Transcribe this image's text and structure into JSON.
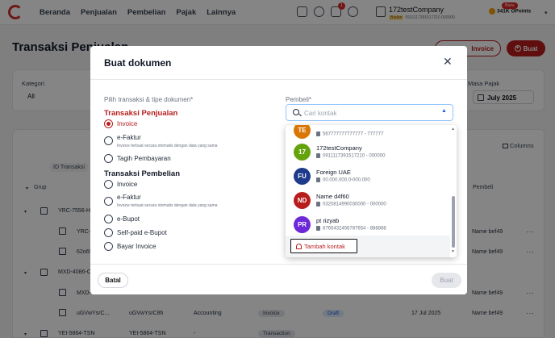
{
  "navbar": {
    "menu": [
      "Beranda",
      "Penjualan",
      "Pembelian",
      "Pajak",
      "Lainnya"
    ],
    "notification_count": "1",
    "company": {
      "name": "172testCompany",
      "badge": "Badan",
      "npwp": "0911117391517210 000000"
    },
    "points": {
      "new_badge": "Baru",
      "label": "341K OPoints"
    }
  },
  "page": {
    "title": "Transaksi Penjualan",
    "invoice_button": "Invoice",
    "create_button": "Buat",
    "filters": {
      "category_label": "Kategori",
      "category_value": "All",
      "tax_period_label": "Masa Pajak",
      "tax_period_value": "July 2025"
    },
    "columns_button": "Columns",
    "id_column_chip": "ID Transaksi",
    "header_group": "Grup",
    "header_buyer": "Pembeli",
    "rows": [
      {
        "id": "YRC-7556-H",
        "buyer": ""
      },
      {
        "id": "YRC-",
        "buyer": "Name bef49"
      },
      {
        "id": "62o65",
        "buyer": "Name bef49"
      },
      {
        "id": "MXD-4086-C",
        "buyer": ""
      },
      {
        "id": "MXD-",
        "buyer": "Name bef49"
      },
      {
        "id": "uGVwYsrC...",
        "id2": "uGVwYsrC8h",
        "category": "Accounting",
        "type": "Invoice",
        "status": "Draft",
        "date": "17 Jul 2025",
        "buyer": "Name bef49"
      },
      {
        "id": "YEI-5864-TSN",
        "id2": "YEI-5864-TSN",
        "category": "-",
        "type": "Transaction",
        "buyer": ""
      }
    ]
  },
  "modal": {
    "title": "Buat dokumen",
    "choose_label": "Pilih transaksi & tipe dokumen*",
    "sales_group": "Transaksi Penjualan",
    "sales_options": [
      {
        "label": "Invoice",
        "selected": true
      },
      {
        "label": "e-Faktur",
        "desc": "Invoice terbuat secara otomatis dengan data yang sama"
      },
      {
        "label": "Tagih Pembayaran"
      }
    ],
    "purchase_group": "Transaksi Pembelian",
    "purchase_options": [
      {
        "label": "Invoice"
      },
      {
        "label": "e-Faktur",
        "desc": "Invoice terbuat secara otomatis dengan data yang sama"
      },
      {
        "label": "e-Bupot"
      },
      {
        "label": "Self-paid e-Bupot"
      },
      {
        "label": "Bayar Invoice"
      }
    ],
    "buyer_label": "Pembeli*",
    "buyer_placeholder": "Cari kontak",
    "cancel_button": "Batal",
    "submit_button": "Buat"
  },
  "contacts": [
    {
      "initials": "TE",
      "name": "",
      "npwp": "567777777777777 - 777777",
      "color": "#d97706"
    },
    {
      "initials": "17",
      "name": "172testCompany",
      "npwp": "0911117391517210 - 000000",
      "color": "#65a30d"
    },
    {
      "initials": "FU",
      "name": "Foreign UAE",
      "npwp": "00.000.000.0-000.000",
      "color": "#1e3a8a"
    },
    {
      "initials": "ND",
      "name": "Name d4f60",
      "npwp": "0320814990030000 - 000000",
      "color": "#b91c1c"
    },
    {
      "initials": "PR",
      "name": "pt rizyab",
      "npwp": "8765432456787654 - 888888",
      "color": "#6d28d9"
    }
  ],
  "add_contact_button": "Tambah kontak"
}
